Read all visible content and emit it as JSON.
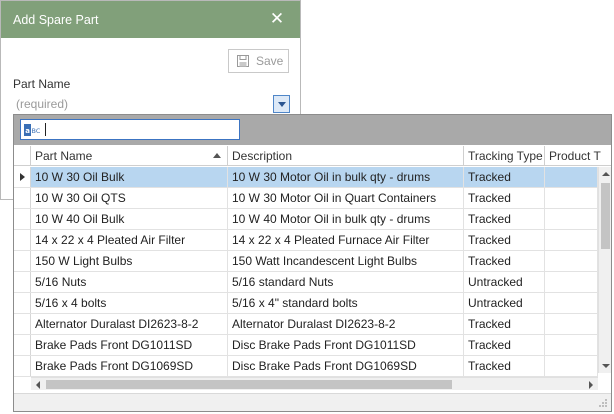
{
  "dialog": {
    "title": "Add Spare Part",
    "save_label": "Save",
    "part_name_label": "Part Name",
    "part_name_placeholder": "(required)",
    "title_color": "#81a07a"
  },
  "search": {
    "value": ""
  },
  "grid": {
    "columns": [
      "Part Name",
      "Description",
      "Tracking Type",
      "Product T"
    ],
    "rows": [
      {
        "part": "10 W 30 Oil Bulk",
        "description": "10 W 30 Motor Oil in bulk qty - drums",
        "tracking": "Tracked",
        "product": "",
        "selected": true
      },
      {
        "part": "10 W 30 Oil QTS",
        "description": "10 W 30 Motor Oil in Quart Containers",
        "tracking": "Tracked",
        "product": "",
        "selected": false
      },
      {
        "part": "10 W 40 Oil Bulk",
        "description": "10 W 40 Motor Oil in bulk qty - drums",
        "tracking": "Tracked",
        "product": "",
        "selected": false
      },
      {
        "part": "14 x 22 x 4 Pleated Air Filter",
        "description": "14 x 22 x 4 Pleated Furnace Air Filter",
        "tracking": "Tracked",
        "product": "",
        "selected": false
      },
      {
        "part": "150 W Light Bulbs",
        "description": "150 Watt Incandescent Light Bulbs",
        "tracking": "Tracked",
        "product": "",
        "selected": false
      },
      {
        "part": "5/16 Nuts",
        "description": "5/16 standard Nuts",
        "tracking": "Untracked",
        "product": "",
        "selected": false
      },
      {
        "part": "5/16 x 4 bolts",
        "description": "5/16 x 4\" standard bolts",
        "tracking": "Untracked",
        "product": "",
        "selected": false
      },
      {
        "part": "Alternator Duralast DI2623-8-2",
        "description": "Alternator Duralast DI2623-8-2",
        "tracking": "Tracked",
        "product": "",
        "selected": false
      },
      {
        "part": "Brake Pads Front DG1011SD",
        "description": "Disc Brake Pads Front DG1011SD",
        "tracking": "Tracked",
        "product": "",
        "selected": false
      },
      {
        "part": "Brake Pads Front DG1069SD",
        "description": "Disc Brake Pads Front DG1069SD",
        "tracking": "Tracked",
        "product": "",
        "selected": false
      }
    ],
    "selected_color": "#b8d6f0"
  }
}
